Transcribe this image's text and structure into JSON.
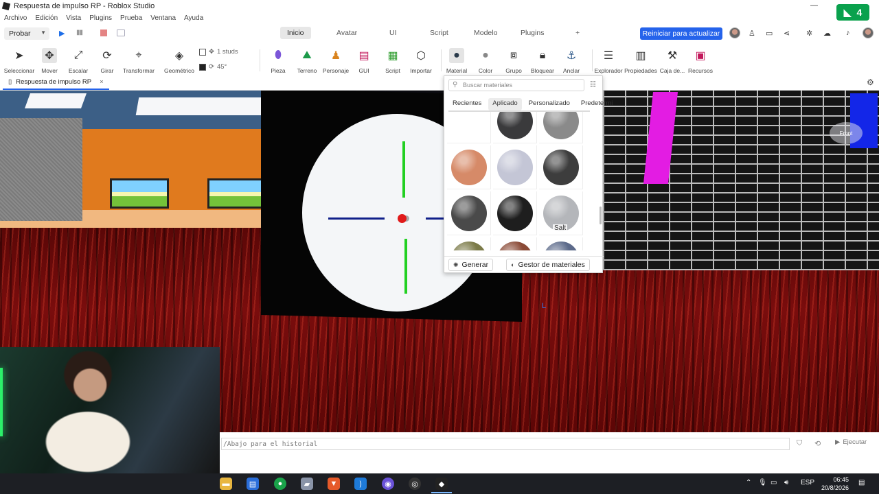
{
  "window": {
    "title": "Respuesta de impulso RP - Roblox Studio",
    "minimize_glyph": "—",
    "badge_value": "4"
  },
  "menu": [
    "Archivo",
    "Edición",
    "Vista",
    "Plugins",
    "Prueba",
    "Ventana",
    "Ayuda"
  ],
  "test_controls": {
    "probar_label": "Probar"
  },
  "ribbon_tabs": [
    {
      "label": "Inicio",
      "active": true
    },
    {
      "label": "Avatar",
      "active": false
    },
    {
      "label": "UI",
      "active": false
    },
    {
      "label": "Script",
      "active": false
    },
    {
      "label": "Modelo",
      "active": false
    },
    {
      "label": "Plugins",
      "active": false
    },
    {
      "label": "+",
      "active": false
    }
  ],
  "restart_button": "Reiniciar para actualizar",
  "tools": {
    "seleccionar": "Seleccionar",
    "mover": "Mover",
    "escalar": "Escalar",
    "girar": "Girar",
    "transformar": "Transformar",
    "geometrico": "Geométrico",
    "pieza": "Pieza",
    "terreno": "Terreno",
    "personaje": "Personaje",
    "gui": "GUI",
    "script": "Script",
    "importar": "Importar",
    "material": "Material",
    "color": "Color",
    "grupo": "Grupo",
    "bloquear": "Bloquear",
    "anclar": "Anclar",
    "explorador": "Explorador",
    "propiedades": "Propiedades",
    "caja": "Caja de...",
    "recursos": "Recursos"
  },
  "snap": {
    "studs": "1 studs",
    "degrees": "45°",
    "studs_checked": false,
    "degrees_checked": true
  },
  "doc_tab": {
    "label": "Respuesta de impulso RP",
    "close": "×"
  },
  "material_picker": {
    "search_placeholder": "Buscar materiales",
    "tabs": [
      {
        "label": "Recientes",
        "active": false
      },
      {
        "label": "Aplicado",
        "active": true
      },
      {
        "label": "Personalizado",
        "active": false
      },
      {
        "label": "Predetermi",
        "active": false
      }
    ],
    "tooltip": "Salt",
    "generate_button": "Generar",
    "manager_button": "Gestor de materiales",
    "swatch_colors": [
      "#ffffff",
      "#3a3a3c",
      "#8a8a8a",
      "#d68a68",
      "#c4c6d6",
      "#3d3d3d",
      "#4a4a4a",
      "#1e1e1e",
      "#b4b6ba",
      "#7b7a48",
      "#8a4a36",
      "#5c6a8a"
    ]
  },
  "viewport": {
    "cube_label": "Front",
    "cursor_glyph": "L"
  },
  "command_bar": {
    "placeholder": "/Abajo para el historial",
    "run_label": "Ejecutar"
  },
  "taskbar": {
    "language": "ESP",
    "time": "06:45",
    "date": "20/8/2026"
  }
}
